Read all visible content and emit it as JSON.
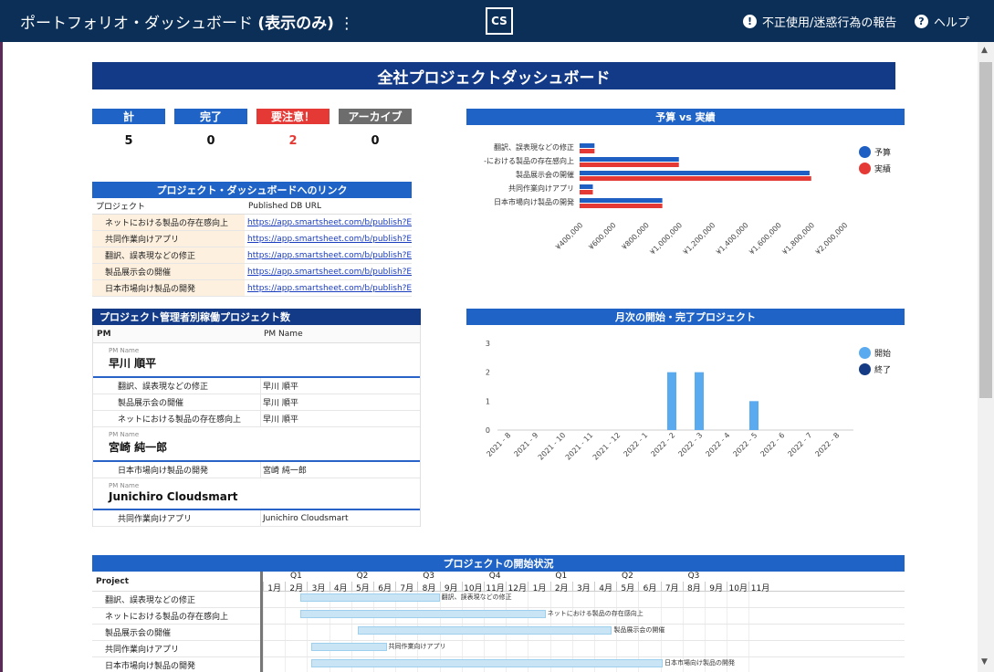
{
  "header": {
    "title_prefix": "ポートフォリオ・ダッシュボード ",
    "title_suffix": "(表示のみ)",
    "menu_glyph": "⋮",
    "logo_text": "CS",
    "report_label": "不正使用/迷惑行為の報告",
    "help_label": "ヘルプ"
  },
  "dashboard_title": "全社プロジェクトダッシュボード",
  "counters": [
    {
      "label": "計",
      "value": "5",
      "color": "#1f63c6",
      "value_color": "#111111"
    },
    {
      "label": "完了",
      "value": "0",
      "color": "#1f63c6",
      "value_color": "#111111"
    },
    {
      "label": "要注意！",
      "value": "2",
      "color": "#e53935",
      "value_color": "#e53935"
    },
    {
      "label": "アーカイブ",
      "value": "0",
      "color": "#6d6d6d",
      "value_color": "#111111"
    }
  ],
  "links_section": {
    "title": "プロジェクト・ダッシュボードへのリンク",
    "col_project": "プロジェクト",
    "col_url": "Published DB URL",
    "rows": [
      {
        "project": "ネットにおける製品の存在感向上",
        "url": "https://app.smartsheet.com/b/publish?EQBCT"
      },
      {
        "project": "共同作業向けアプリ",
        "url": "https://app.smartsheet.com/b/publish?EQBCT"
      },
      {
        "project": "翻訳、誤表現などの修正",
        "url": "https://app.smartsheet.com/b/publish?EQBCT"
      },
      {
        "project": "製品展示会の開催",
        "url": "https://app.smartsheet.com/b/publish?EQBCT"
      },
      {
        "project": "日本市場向け製品の開発",
        "url": "https://app.smartsheet.com/b/publish?EQBCT"
      }
    ]
  },
  "pm_section": {
    "title": "プロジェクト管理者別稼働プロジェクト数",
    "col_pm": "PM",
    "col_pm_name": "PM Name",
    "group_caption": "PM Name",
    "groups": [
      {
        "name": "早川 順平",
        "rows": [
          {
            "project": "翻訳、誤表現などの修正",
            "pm": "早川 順平"
          },
          {
            "project": "製品展示会の開催",
            "pm": "早川 順平"
          },
          {
            "project": "ネットにおける製品の存在感向上",
            "pm": "早川 順平"
          }
        ]
      },
      {
        "name": "宮崎 純一郎",
        "rows": [
          {
            "project": "日本市場向け製品の開発",
            "pm": "宮崎 純一郎"
          }
        ]
      },
      {
        "name": "Junichiro Cloudsmart",
        "rows": [
          {
            "project": "共同作業向けアプリ",
            "pm": "Junichiro Cloudsmart"
          }
        ]
      }
    ]
  },
  "budget_chart_title": "予算 vs 実績",
  "monthly_chart_title": "月次の開始・完了プロジェクト",
  "chart_data": [
    {
      "type": "bar",
      "orientation": "horizontal",
      "title": "予算 vs 実績",
      "categories": [
        "翻訳、誤表現などの修正",
        "-における製品の存在感向上",
        "製品展示会の開催",
        "共同作業向けアプリ",
        "日本市場向け製品の開発"
      ],
      "series": [
        {
          "name": "予算",
          "color": "#1f5fc4",
          "values": [
            490000,
            1000000,
            1790000,
            480000,
            900000
          ]
        },
        {
          "name": "実績",
          "color": "#e53935",
          "values": [
            490000,
            1000000,
            1800000,
            480000,
            900000
          ]
        }
      ],
      "xticks": [
        "¥400,000",
        "¥600,000",
        "¥800,000",
        "¥1,000,000",
        "¥1,200,000",
        "¥1,400,000",
        "¥1,600,000",
        "¥1,800,000",
        "¥2,000,000"
      ],
      "xlim": [
        400000,
        2000000
      ],
      "legend": "right"
    },
    {
      "type": "bar",
      "title": "月次の開始・完了プロジェクト",
      "categories": [
        "2021 - 8",
        "2021 - 9",
        "2021 - 10",
        "2021 - 11",
        "2021 - 12",
        "2022 - 1",
        "2022 - 2",
        "2022 - 3",
        "2022 - 4",
        "2022 - 5",
        "2022 - 6",
        "2022 - 7",
        "2022 - 8"
      ],
      "series": [
        {
          "name": "開始",
          "color": "#5aaaf0",
          "values": [
            0,
            0,
            0,
            0,
            0,
            0,
            2,
            2,
            0,
            1,
            0,
            0,
            0
          ]
        },
        {
          "name": "終了",
          "color": "#143b84",
          "values": [
            0,
            0,
            0,
            0,
            0,
            0,
            0,
            0,
            0,
            0,
            0,
            0,
            0
          ]
        }
      ],
      "yticks": [
        "0",
        "1",
        "2",
        "3"
      ],
      "ylim": [
        0,
        3
      ],
      "legend": "right"
    }
  ],
  "gantt": {
    "title": "プロジェクトの開始状況",
    "col_project": "Project",
    "quarters": [
      "Q1",
      "Q2",
      "Q3",
      "Q4",
      "Q1",
      "Q2",
      "Q3"
    ],
    "months": [
      "1月",
      "2月",
      "3月",
      "4月",
      "5月",
      "6月",
      "7月",
      "8月",
      "9月",
      "10月",
      "11月",
      "12月",
      "1月",
      "2月",
      "3月",
      "4月",
      "5月",
      "6月",
      "7月",
      "8月",
      "9月",
      "10月",
      "11月"
    ],
    "rows": [
      {
        "project": "翻訳、誤表現などの修正",
        "bar_label": "翻訳、誤表現などの修正",
        "start": 1.7,
        "end": 8.0
      },
      {
        "project": "ネットにおける製品の存在感向上",
        "bar_label": "ネットにおける製品の存在感向上",
        "start": 1.7,
        "end": 12.8
      },
      {
        "project": "製品展示会の開催",
        "bar_label": "製品展示会の開催",
        "start": 4.3,
        "end": 15.8
      },
      {
        "project": "共同作業向けアプリ",
        "bar_label": "共同作業向けアプリ",
        "start": 2.2,
        "end": 5.6
      },
      {
        "project": "日本市場向け製品の開発",
        "bar_label": "日本市場向け製品の開発",
        "start": 2.2,
        "end": 18.1
      }
    ]
  }
}
